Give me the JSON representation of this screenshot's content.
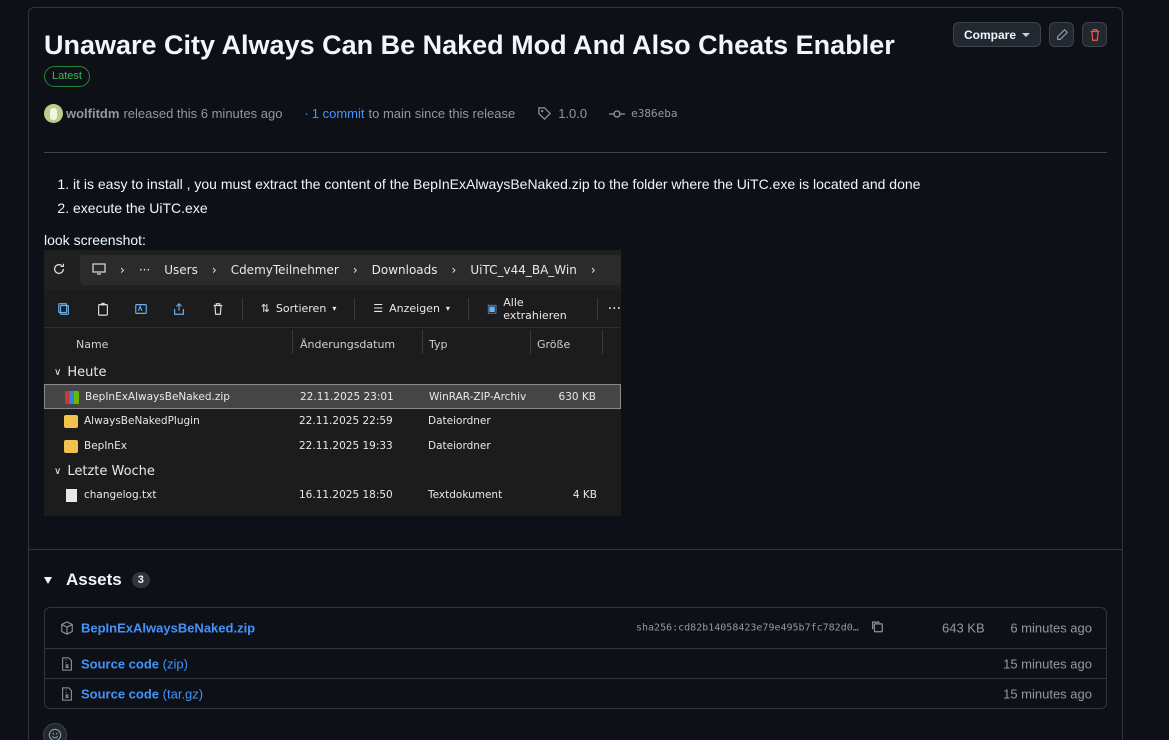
{
  "release": {
    "title": "Unaware City Always Can Be Naked Mod And Also Cheats Enabler",
    "badge": "Latest",
    "compare_label": "Compare",
    "author": "wolfitdm",
    "released_text": "released this 6 minutes ago",
    "commits_prefix": "·",
    "commits_link": "1 commit",
    "commits_suffix": "to main since this release",
    "tag": "1.0.0",
    "commit_sha": "e386eba"
  },
  "body": {
    "steps": [
      "it is easy to install , you must extract the content of the BepInExAlwaysBeNaked.zip to the folder where the UiTC.exe is located and done",
      "execute the UiTC.exe"
    ],
    "look_screenshot": "look screenshot:"
  },
  "explorer": {
    "path": [
      "···",
      "Users",
      "CdemyTeilnehmer",
      "Downloads",
      "UiTC_v44_BA_Win"
    ],
    "toolbar": {
      "sort": "Sortieren",
      "view": "Anzeigen",
      "extract": "Alle extrahieren",
      "more": "···"
    },
    "columns": {
      "name": "Name",
      "date": "Änderungsdatum",
      "type": "Typ",
      "size": "Größe"
    },
    "groups": {
      "today": "Heute",
      "last_week": "Letzte Woche"
    },
    "files_today": [
      {
        "name": "BepInExAlwaysBeNaked.zip",
        "date": "22.11.2025 23:01",
        "type": "WinRAR-ZIP-Archiv",
        "size": "630 KB",
        "icon": "zip-icon"
      },
      {
        "name": "AlwaysBeNakedPlugin",
        "date": "22.11.2025 22:59",
        "type": "Dateiordner",
        "size": "",
        "icon": "folder-icon"
      },
      {
        "name": "BepInEx",
        "date": "22.11.2025 19:33",
        "type": "Dateiordner",
        "size": "",
        "icon": "folder-icon"
      }
    ],
    "files_last_week": [
      {
        "name": "changelog.txt",
        "date": "16.11.2025 18:50",
        "type": "Textdokument",
        "size": "4 KB",
        "icon": "text-file-icon"
      }
    ]
  },
  "assets": {
    "heading": "Assets",
    "count": "3",
    "items": [
      {
        "name": "BepInExAlwaysBeNaked.zip",
        "suffix": "",
        "sha": "sha256:cd82b14058423e79e495b7fc782d0…",
        "size": "643 KB",
        "when": "6 minutes ago"
      },
      {
        "name": "Source code",
        "suffix": "(zip)",
        "sha": "",
        "size": "",
        "when": "15 minutes ago"
      },
      {
        "name": "Source code",
        "suffix": "(tar.gz)",
        "sha": "",
        "size": "",
        "when": "15 minutes ago"
      }
    ]
  },
  "colors": {
    "link": "#4493f8",
    "latest_green": "#3fb950",
    "danger": "#f85149",
    "bg": "#0d1117"
  }
}
